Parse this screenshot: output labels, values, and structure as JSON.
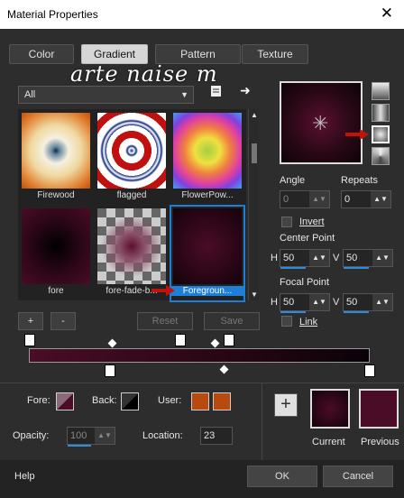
{
  "window": {
    "title": "Material Properties",
    "close_glyph": "✕"
  },
  "tabs": [
    {
      "label": "Color"
    },
    {
      "label": "Gradient"
    },
    {
      "label": "Pattern"
    },
    {
      "label": "Texture"
    }
  ],
  "watermark": "arte naise m",
  "dropdown": {
    "value": "All"
  },
  "gradients": [
    {
      "label": "Firewood"
    },
    {
      "label": "flagged"
    },
    {
      "label": "FlowerPow..."
    },
    {
      "label": "fore"
    },
    {
      "label": "fore-fade-b..."
    },
    {
      "label": "Foregroun..."
    }
  ],
  "buttons": {
    "add": "+",
    "remove": "-",
    "reset": "Reset",
    "save": "Save"
  },
  "angle": {
    "label": "Angle",
    "value": "0"
  },
  "repeats": {
    "label": "Repeats",
    "value": "0"
  },
  "invert": {
    "label": "Invert"
  },
  "center": {
    "label": "Center Point",
    "h_label": "H",
    "h_value": "50",
    "v_label": "V",
    "v_value": "50"
  },
  "focal": {
    "label": "Focal Point",
    "h_label": "H",
    "h_value": "50",
    "v_label": "V",
    "v_value": "50"
  },
  "link": {
    "label": "Link"
  },
  "fore": {
    "label": "Fore:"
  },
  "back": {
    "label": "Back:"
  },
  "user": {
    "label": "User:",
    "color": "#b84a10"
  },
  "opacity": {
    "label": "Opacity:",
    "value": "100"
  },
  "location": {
    "label": "Location:",
    "value": "23"
  },
  "plus_label": "+",
  "current": {
    "label": "Current"
  },
  "previous": {
    "label": "Previous"
  },
  "footer": {
    "help": "Help",
    "ok": "OK",
    "cancel": "Cancel"
  },
  "colors": {
    "accent": "#1e7fd8",
    "selection_arrow": "#c0140a"
  }
}
